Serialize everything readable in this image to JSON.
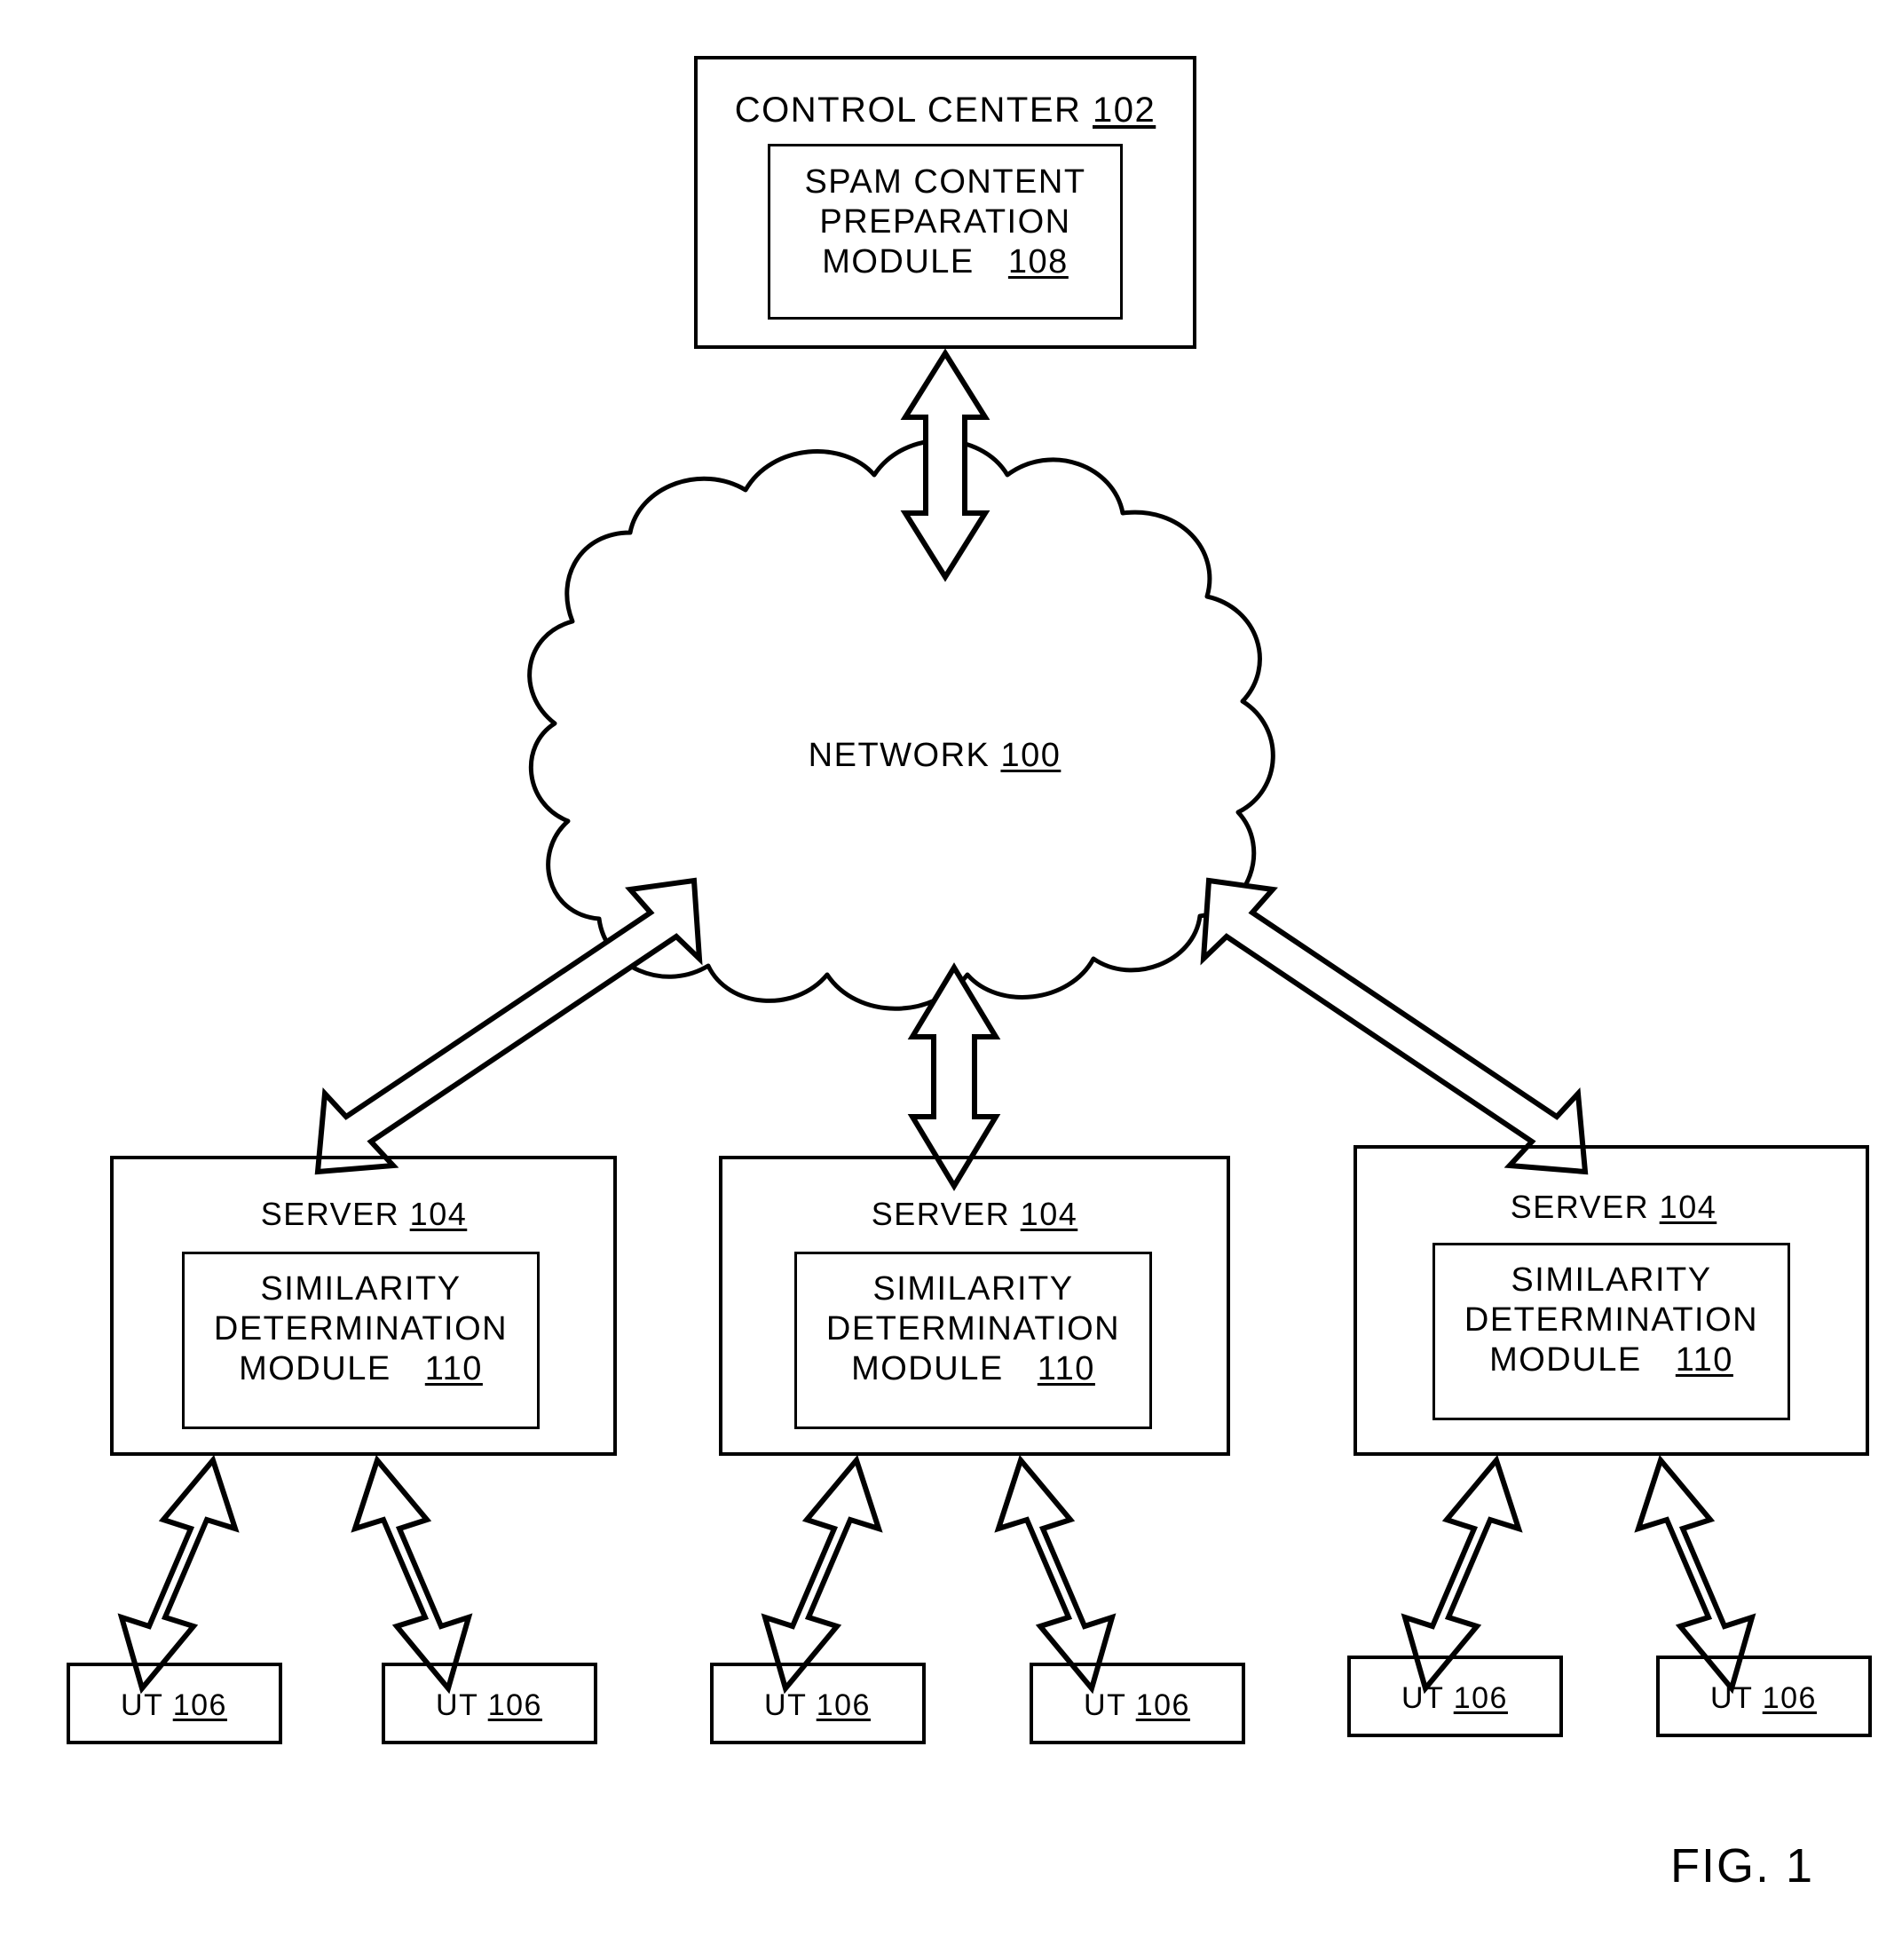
{
  "figure": {
    "caption": "FIG. 1",
    "control_center": {
      "title": "CONTROL CENTER",
      "ref": "102",
      "module": {
        "line1": "SPAM CONTENT",
        "line2": "PREPARATION",
        "line3": "MODULE",
        "ref": "108"
      }
    },
    "network": {
      "title": "NETWORK",
      "ref": "100"
    },
    "servers": [
      {
        "title": "SERVER",
        "ref": "104",
        "module": {
          "line1": "SIMILARITY",
          "line2": "DETERMINATION",
          "line3": "MODULE",
          "ref": "110"
        }
      },
      {
        "title": "SERVER",
        "ref": "104",
        "module": {
          "line1": "SIMILARITY",
          "line2": "DETERMINATION",
          "line3": "MODULE",
          "ref": "110"
        }
      },
      {
        "title": "SERVER",
        "ref": "104",
        "module": {
          "line1": "SIMILARITY",
          "line2": "DETERMINATION",
          "line3": "MODULE",
          "ref": "110"
        }
      }
    ],
    "user_terminals": [
      {
        "title": "UT",
        "ref": "106"
      },
      {
        "title": "UT",
        "ref": "106"
      },
      {
        "title": "UT",
        "ref": "106"
      },
      {
        "title": "UT",
        "ref": "106"
      },
      {
        "title": "UT",
        "ref": "106"
      },
      {
        "title": "UT",
        "ref": "106"
      }
    ],
    "colors": {
      "line": "#000000",
      "background": "#ffffff"
    }
  }
}
